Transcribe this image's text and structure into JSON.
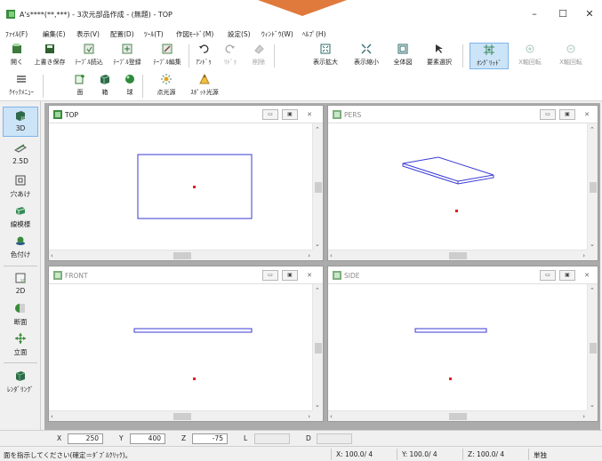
{
  "window": {
    "title": "A's****(**,***) - 3次元部品作成 - (無題) - TOP",
    "minimize": "–",
    "maximize": "☐",
    "close": "✕"
  },
  "menu": [
    "ﾌｧｲﾙ(F)",
    "編集(E)",
    "表示(V)",
    "配置(D)",
    "ﾂｰﾙ(T)",
    "作図ﾓｰﾄﾞ(M)",
    "設定(S)",
    "ｳｨﾝﾄﾞｳ(W)",
    "ﾍﾙﾌﾟ(H)"
  ],
  "toolbar1": {
    "open": "開く",
    "save": "上書き保存",
    "table_read": "ﾃｰﾌﾞﾙ読込",
    "table_register": "ﾃｰﾌﾞﾙ登録",
    "table_edit": "ﾃｰﾌﾞﾙ編集",
    "undo": "ｱﾝﾄﾞｩ",
    "redo": "ﾘﾄﾞｩ",
    "delete": "削除",
    "zoom_in": "表示拡大",
    "zoom_out": "表示縮小",
    "fit_all": "全体図",
    "select": "要素選択",
    "ongrid": "ｵﾝｸﾞﾘｯﾄﾞ",
    "x_rotate": "X軸回転",
    "x_rotate2": "X軸回転"
  },
  "toolbar2": {
    "quick_menu": "ｸｲｯｸﾒﾆｭｰ",
    "face": "面",
    "box": "箱",
    "sphere": "球",
    "point_light": "点光源",
    "spot_light": "ｽﾎﾟｯﾄ光源"
  },
  "sidebar": {
    "view3d": "3D",
    "view25d": "2.5D",
    "hole": "穴あけ",
    "wireframe": "線模様",
    "color": "色付け",
    "view2d": "2D",
    "section": "断面",
    "elevation": "立面",
    "rendering": "ﾚﾝﾀﾞﾘﾝｸﾞ",
    "badge_3d": "3D",
    "badge_2d": "2D"
  },
  "viewports": {
    "top": "TOP",
    "pers": "PERS",
    "front": "FRONT",
    "side": "SIDE",
    "icon_badge": "3D"
  },
  "coords": {
    "x_label": "X",
    "x_value": "250",
    "y_label": "Y",
    "y_value": "400",
    "z_label": "Z",
    "z_value": "-75",
    "l_label": "L",
    "d_label": "D"
  },
  "status": {
    "message": "面を指示してください(確定＝ﾀﾞﾌﾞﾙｸﾘｯｸ)。",
    "x": "X: 100.0/ 4",
    "y": "Y: 100.0/ 4",
    "z": "Z: 100.0/ 4",
    "mode": "単独"
  },
  "colors": {
    "accent": "#3a3ad6",
    "point": "#e02020",
    "active_bg": "#cce4f7",
    "title_accent": "#e07a3c"
  }
}
